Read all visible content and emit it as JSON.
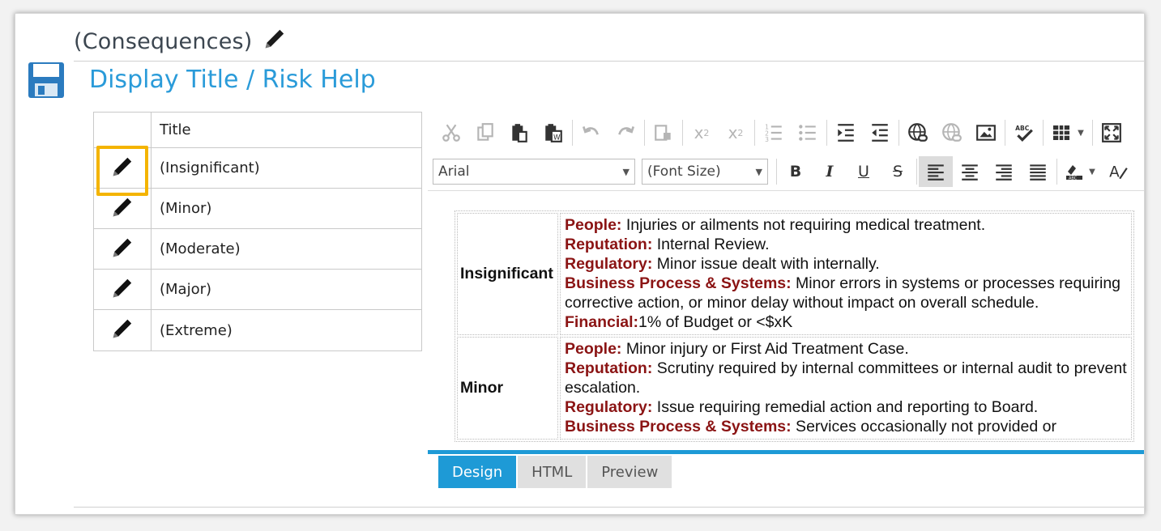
{
  "header": {
    "title": "(Consequences)",
    "section_title": "Display Title / Risk Help"
  },
  "list": {
    "column_header": "Title",
    "rows": [
      {
        "label": "(Insignificant)",
        "highlighted": true
      },
      {
        "label": "(Minor)"
      },
      {
        "label": "(Moderate)"
      },
      {
        "label": "(Major)"
      },
      {
        "label": "(Extreme)"
      }
    ]
  },
  "editor": {
    "font_family": "Arial",
    "font_size": "(Font Size)",
    "toolbar_icons": [
      "cut-icon",
      "copy-icon",
      "paste-icon",
      "paste-word-icon",
      "undo-icon",
      "redo-icon",
      "paste-text-icon",
      "superscript-icon",
      "subscript-icon",
      "ordered-list-icon",
      "unordered-list-icon",
      "indent-icon",
      "outdent-icon",
      "insert-link-icon",
      "remove-link-icon",
      "insert-image-icon",
      "spellcheck-icon",
      "insert-table-icon",
      "fullscreen-icon"
    ],
    "format_icons": [
      "bold-icon",
      "italic-icon",
      "underline-icon",
      "strikethrough-icon",
      "align-left-icon",
      "align-center-icon",
      "align-right-icon",
      "justify-icon",
      "text-color-icon",
      "format-icon"
    ],
    "rows": [
      {
        "level": "Insignificant",
        "items": [
          {
            "label": "People:",
            "text": " Injuries or ailments not requiring medical treatment."
          },
          {
            "label": "Reputation:",
            "text": " Internal Review."
          },
          {
            "label": "Regulatory:",
            "text": " Minor issue dealt with internally."
          },
          {
            "label": "Business Process & Systems:",
            "text": " Minor errors in systems or processes requiring corrective action, or minor delay without impact on overall schedule."
          },
          {
            "label": "Financial:",
            "text": "1% of Budget or <$xK"
          }
        ]
      },
      {
        "level": "Minor",
        "items": [
          {
            "label": "People:",
            "text": " Minor injury or First Aid Treatment Case."
          },
          {
            "label": "Reputation:",
            "text": " Scrutiny required by internal committees or internal audit to prevent escalation."
          },
          {
            "label": "Regulatory:",
            "text": " Issue requiring remedial action and reporting to Board."
          },
          {
            "label": "Business Process & Systems:",
            "text": " Services occasionally not provided or"
          }
        ]
      }
    ],
    "tabs": [
      "Design",
      "HTML",
      "Preview"
    ],
    "active_tab": "Design"
  },
  "colors": {
    "accent": "#1e9ad6",
    "label": "#8b1414",
    "highlight": "#f4b400"
  }
}
